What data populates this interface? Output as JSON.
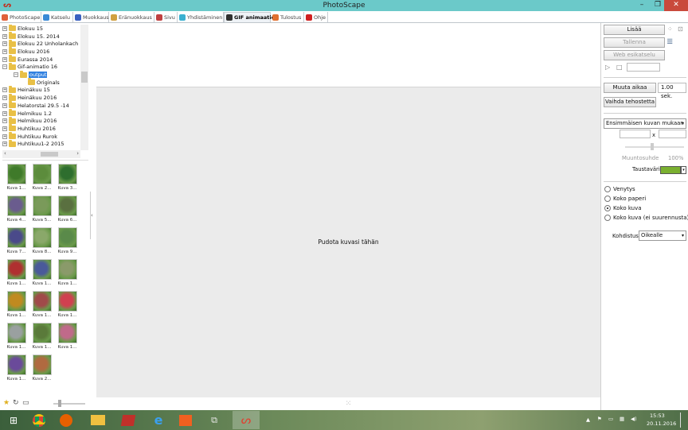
{
  "window": {
    "title": "PhotoScape",
    "buttons": {
      "min": "–",
      "max": "❐",
      "close": "✕"
    }
  },
  "tabs": [
    {
      "label": "PhotoScape",
      "color": "#e0603a"
    },
    {
      "label": "Katselu",
      "color": "#3a8ad6"
    },
    {
      "label": "Muokkaus",
      "color": "#3a60c0"
    },
    {
      "label": "Eränuokkaus",
      "color": "#d0a040"
    },
    {
      "label": "Sivu",
      "color": "#c04040"
    },
    {
      "label": "Yhdistäminen",
      "color": "#3ab0d0"
    },
    {
      "label": "GIF animaatio",
      "color": "#303030"
    },
    {
      "label": "Tulostus",
      "color": "#e07030"
    },
    {
      "label": "Ohje",
      "color": "#d02020"
    }
  ],
  "tree": {
    "items": [
      {
        "label": "Elokuu 15",
        "exp": "+"
      },
      {
        "label": "Elokuu 15. 2014",
        "exp": "+"
      },
      {
        "label": "Elokuu 22 Unholankach",
        "exp": "+"
      },
      {
        "label": "Elokuu 2016",
        "exp": "+"
      },
      {
        "label": "Eurassa 2014",
        "exp": "+"
      },
      {
        "label": "Gif-animatio 16",
        "exp": "−"
      },
      {
        "label": "output",
        "exp": "−"
      },
      {
        "label": "Originals",
        "exp": ""
      },
      {
        "label": "Heinäkuu 15",
        "exp": "+"
      },
      {
        "label": "Heinäkuu 2016",
        "exp": "+"
      },
      {
        "label": "Helatorstai 29.5 -14",
        "exp": "+"
      },
      {
        "label": "Helmikuu 1.2",
        "exp": "+"
      },
      {
        "label": "Helmikuu 2016",
        "exp": "+"
      },
      {
        "label": "Huhtikuu 2016",
        "exp": "+"
      },
      {
        "label": "Huhtikuu Rurok",
        "exp": "+"
      },
      {
        "label": "Huhtikuu1-2 2015",
        "exp": "+"
      }
    ],
    "scroll_left": "‹",
    "scroll_right": "›"
  },
  "thumbnails": [
    {
      "label": "Kuva 1...",
      "color": "#3f7a2a"
    },
    {
      "label": "Kuva 2...",
      "color": "#5c8c3c"
    },
    {
      "label": "Kuva 3...",
      "color": "#2e6e2e"
    },
    {
      "label": "Kuva 4...",
      "color": "#6a5c8e"
    },
    {
      "label": "Kuva 5...",
      "color": "#7a9a5a"
    },
    {
      "label": "Kuva 6...",
      "color": "#5a7040"
    },
    {
      "label": "Kuva 7...",
      "color": "#4a4a8a"
    },
    {
      "label": "Kuva 8...",
      "color": "#8aa86a"
    },
    {
      "label": "Kuva 9...",
      "color": "#5a8a4a"
    },
    {
      "label": "Kuva 1...",
      "color": "#b03030"
    },
    {
      "label": "Kuva 1...",
      "color": "#4a5a9a"
    },
    {
      "label": "Kuva 1...",
      "color": "#8a9a6a"
    },
    {
      "label": "Kuva 1...",
      "color": "#c08a20"
    },
    {
      "label": "Kuva 1...",
      "color": "#a04a4a"
    },
    {
      "label": "Kuva 1...",
      "color": "#d04050"
    },
    {
      "label": "Kuva 1...",
      "color": "#9aa0a0"
    },
    {
      "label": "Kuva 1...",
      "color": "#5a7a3a"
    },
    {
      "label": "Kuva 1...",
      "color": "#c06a8a"
    },
    {
      "label": "Kuva 1...",
      "color": "#6a4a9a"
    },
    {
      "label": "Kuva 2...",
      "color": "#b06a40"
    }
  ],
  "center": {
    "drop_text": "Pudota kuvasi tähän",
    "handle": "‹"
  },
  "panel": {
    "add": "Lisää",
    "save": "Tallenna",
    "web_preview": "Web esikatselu",
    "change_time": "Muuta aikaa",
    "time_value": "1.00 sek.",
    "change_effect": "Vaihda tehostetta",
    "size_select": "Ensimmäisen kuvan mukaan",
    "x_sep": "x",
    "ratio_label": "Muuntosuhde",
    "ratio_value": "100%",
    "bg_label": "Taustaväri",
    "bg_color": "#7ab030",
    "radios": [
      "Venytys",
      "Koko paperi",
      "Koko kuva",
      "Koko kuva (ei suurennusta)"
    ],
    "selected_radio": 2,
    "align_label": "Kohdistus",
    "align_value": "Oikealle"
  },
  "taskbar": {
    "time": "15:53",
    "date": "20.11.2016"
  }
}
